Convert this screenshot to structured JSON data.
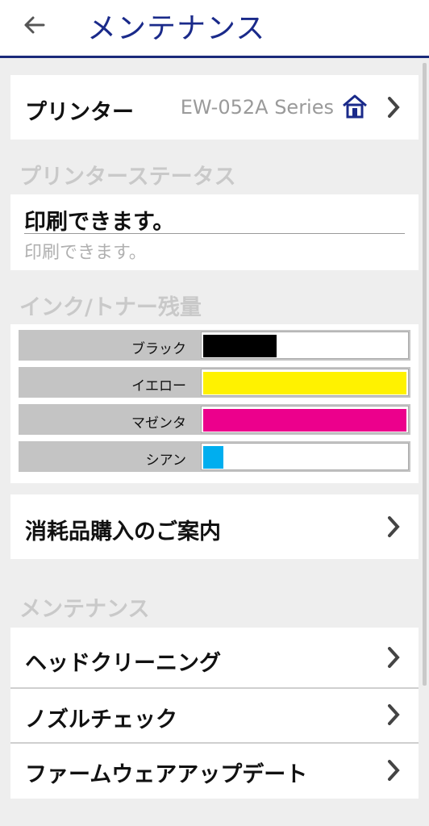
{
  "header": {
    "title": "メンテナンス",
    "back_icon": "back-arrow-icon"
  },
  "printer": {
    "label": "プリンター",
    "name": "EW-052A Series",
    "home_icon": "home-network-icon"
  },
  "status": {
    "section_label": "プリンターステータス",
    "main": "印刷できます。",
    "sub": "印刷できます。"
  },
  "ink": {
    "section_label": "インク/トナー残量",
    "items": [
      {
        "label": "ブラック",
        "color": "#000000",
        "level": 0.36
      },
      {
        "label": "イエロー",
        "color": "#fff200",
        "level": 1.0
      },
      {
        "label": "マゼンタ",
        "color": "#ec008c",
        "level": 1.0
      },
      {
        "label": "シアン",
        "color": "#00aeef",
        "level": 0.1
      }
    ]
  },
  "purchase": {
    "label": "消耗品購入のご案内"
  },
  "maintenance": {
    "section_label": "メンテナンス",
    "items": [
      {
        "label": "ヘッドクリーニング"
      },
      {
        "label": "ノズルチェック"
      },
      {
        "label": "ファームウェアアップデート"
      }
    ]
  }
}
